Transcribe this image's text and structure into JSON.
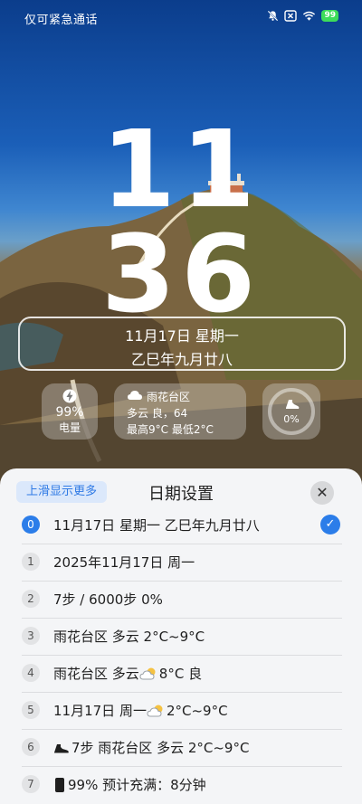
{
  "status_bar": {
    "carrier_text": "仅可紧急通话",
    "battery_level": "99",
    "icons": [
      "bell-off-icon",
      "no-sim-icon",
      "wifi-icon",
      "battery-charging-icon"
    ]
  },
  "clock": {
    "hour": "11",
    "minute": "36"
  },
  "date_box": {
    "line1": "11月17日 星期一",
    "line2": "乙巳年九月廿八"
  },
  "widgets": {
    "battery": {
      "percent": "99%",
      "label": "电量",
      "icon": "lightning-icon"
    },
    "weather": {
      "location": "雨花台区",
      "condition": "多云 良，64",
      "high_low": "最高9°C  最低2°C",
      "icon": "cloud-icon"
    },
    "steps": {
      "percent": "0%",
      "progress": 0,
      "icon": "shoe-icon"
    }
  },
  "sheet": {
    "more_label": "上滑显示更多",
    "title": "日期设置",
    "close_icon": "close-icon",
    "options": [
      {
        "num": "0",
        "text": "11月17日 星期一 乙巳年九月廿八",
        "selected": true
      },
      {
        "num": "1",
        "text": "2025年11月17日 周一"
      },
      {
        "num": "2",
        "text": "7步 / 6000步 0%"
      },
      {
        "num": "3",
        "text": "雨花台区 多云 2°C~9°C"
      },
      {
        "num": "4",
        "pre": "雨花台区 多云 ",
        "icon": "partly-cloudy-icon",
        "post": "8°C 良"
      },
      {
        "num": "5",
        "pre": "11月17日 周一 ",
        "icon": "partly-cloudy-icon",
        "post": "2°C~9°C"
      },
      {
        "num": "6",
        "icon": "shoe-icon",
        "post": "7步 雨花台区 多云 2°C~9°C"
      },
      {
        "num": "7",
        "icon": "phone-icon",
        "post": "99% 预计充满：8分钟"
      }
    ]
  },
  "colors": {
    "accent": "#2b7de9",
    "sheet_bg": "#f4f5f7"
  }
}
